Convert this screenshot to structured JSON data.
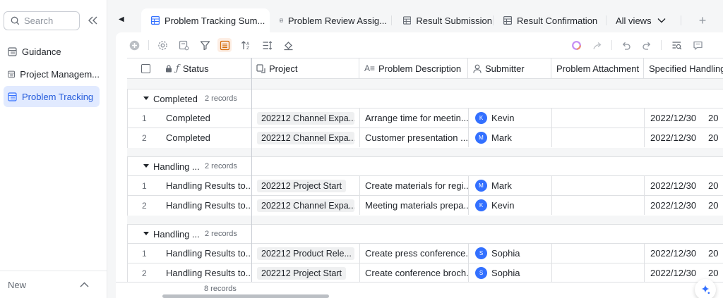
{
  "sidebar": {
    "search_placeholder": "Search",
    "items": [
      {
        "label": "Guidance"
      },
      {
        "label": "Project Managem..."
      },
      {
        "label": "Problem Tracking"
      }
    ],
    "new_label": "New"
  },
  "tabs": [
    {
      "label": "Problem Tracking Sum...",
      "active": true
    },
    {
      "label": "Problem Review Assig...",
      "active": false
    },
    {
      "label": "Result Submission",
      "active": false
    },
    {
      "label": "Result Confirmation",
      "active": false
    }
  ],
  "views_label": "All views",
  "columns": [
    {
      "label": "Status"
    },
    {
      "label": "Project"
    },
    {
      "label": "Problem Description"
    },
    {
      "label": "Submitter"
    },
    {
      "label": "Problem Attachment"
    },
    {
      "label": "Specified Handling"
    }
  ],
  "groups": [
    {
      "name": "Completed",
      "count": "2 records",
      "rows": [
        {
          "idx": "1",
          "status": "Completed",
          "project": "202212 Channel Expa...",
          "description": "Arrange time for meetin...",
          "submitter": "Kevin",
          "initial": "K",
          "date": "2022/12/30",
          "extra": "20"
        },
        {
          "idx": "2",
          "status": "Completed",
          "project": "202212 Channel Expa...",
          "description": "Customer presentation ...",
          "submitter": "Mark",
          "initial": "M",
          "date": "2022/12/30",
          "extra": "20"
        }
      ]
    },
    {
      "name": "Handling ...",
      "count": "2 records",
      "rows": [
        {
          "idx": "1",
          "status": "Handling Results to...",
          "project": "202212 Project Start",
          "description": "Create materials for regi...",
          "submitter": "Mark",
          "initial": "M",
          "date": "2022/12/30",
          "extra": "20"
        },
        {
          "idx": "2",
          "status": "Handling Results to...",
          "project": "202212 Channel Expa...",
          "description": "Meeting materials prepa...",
          "submitter": "Kevin",
          "initial": "K",
          "date": "2022/12/30",
          "extra": "20"
        }
      ]
    },
    {
      "name": "Handling ...",
      "count": "2 records",
      "rows": [
        {
          "idx": "1",
          "status": "Handling Results to...",
          "project": "202212 Product Rele...",
          "description": "Create press conference...",
          "submitter": "Sophia",
          "initial": "S",
          "date": "2022/12/30",
          "extra": "20"
        },
        {
          "idx": "2",
          "status": "Handling Results to...",
          "project": "202212 Project Start",
          "description": "Create conference broch...",
          "submitter": "Sophia",
          "initial": "S",
          "date": "2022/12/30",
          "extra": "20"
        }
      ]
    }
  ],
  "footer_count": "8 records",
  "colors": {
    "accent": "#3370ff",
    "active_bg": "#e1eaff",
    "toolbar_active": "#d46b08"
  }
}
